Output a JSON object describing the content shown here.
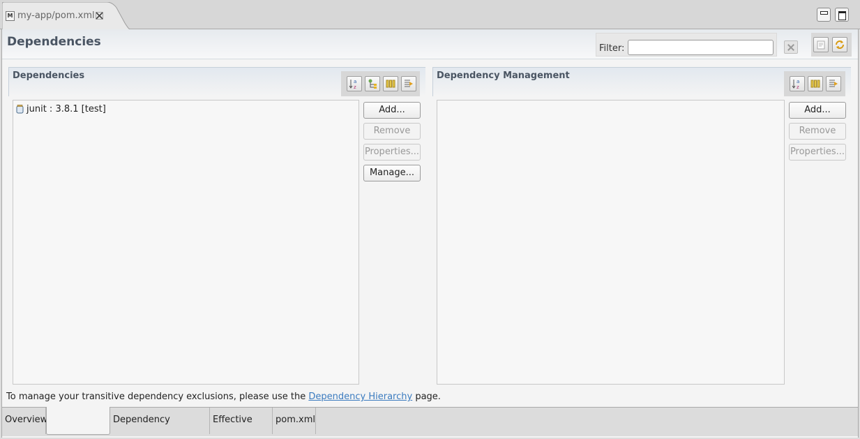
{
  "editor_tab": {
    "icon": "M",
    "title": "my-app/pom.xml"
  },
  "header": {
    "title": "Dependencies",
    "filter_label": "Filter:",
    "filter_value": "",
    "filter_placeholder": ""
  },
  "dependencies": {
    "title": "Dependencies",
    "items": [
      {
        "label": "junit : 3.8.1 [test]"
      }
    ],
    "buttons": {
      "add": "Add...",
      "remove": "Remove",
      "properties": "Properties...",
      "manage": "Manage..."
    }
  },
  "dependency_management": {
    "title": "Dependency Management",
    "items": [],
    "buttons": {
      "add": "Add...",
      "remove": "Remove",
      "properties": "Properties..."
    }
  },
  "hint": {
    "before": "To manage your transitive dependency exclusions, please use the",
    "link": "Dependency Hierarchy",
    "after": "page."
  },
  "page_tabs": [
    {
      "label": "Overview"
    },
    {
      "label": ""
    },
    {
      "label": "Dependency Hierarchy"
    },
    {
      "label": "Effective POM"
    },
    {
      "label": "pom.xml"
    }
  ],
  "icons": [
    "maven-file-icon",
    "close-tab-icon",
    "minimize-icon",
    "maximize-icon",
    "clear-filter-icon",
    "collapse-icon",
    "refresh-icon",
    "sort-az-icon",
    "show-groupid-icon",
    "columns-icon",
    "filter-icon",
    "jar-icon"
  ],
  "colors": {
    "link": "#3b7bbf",
    "section_title": "#4a5563"
  }
}
